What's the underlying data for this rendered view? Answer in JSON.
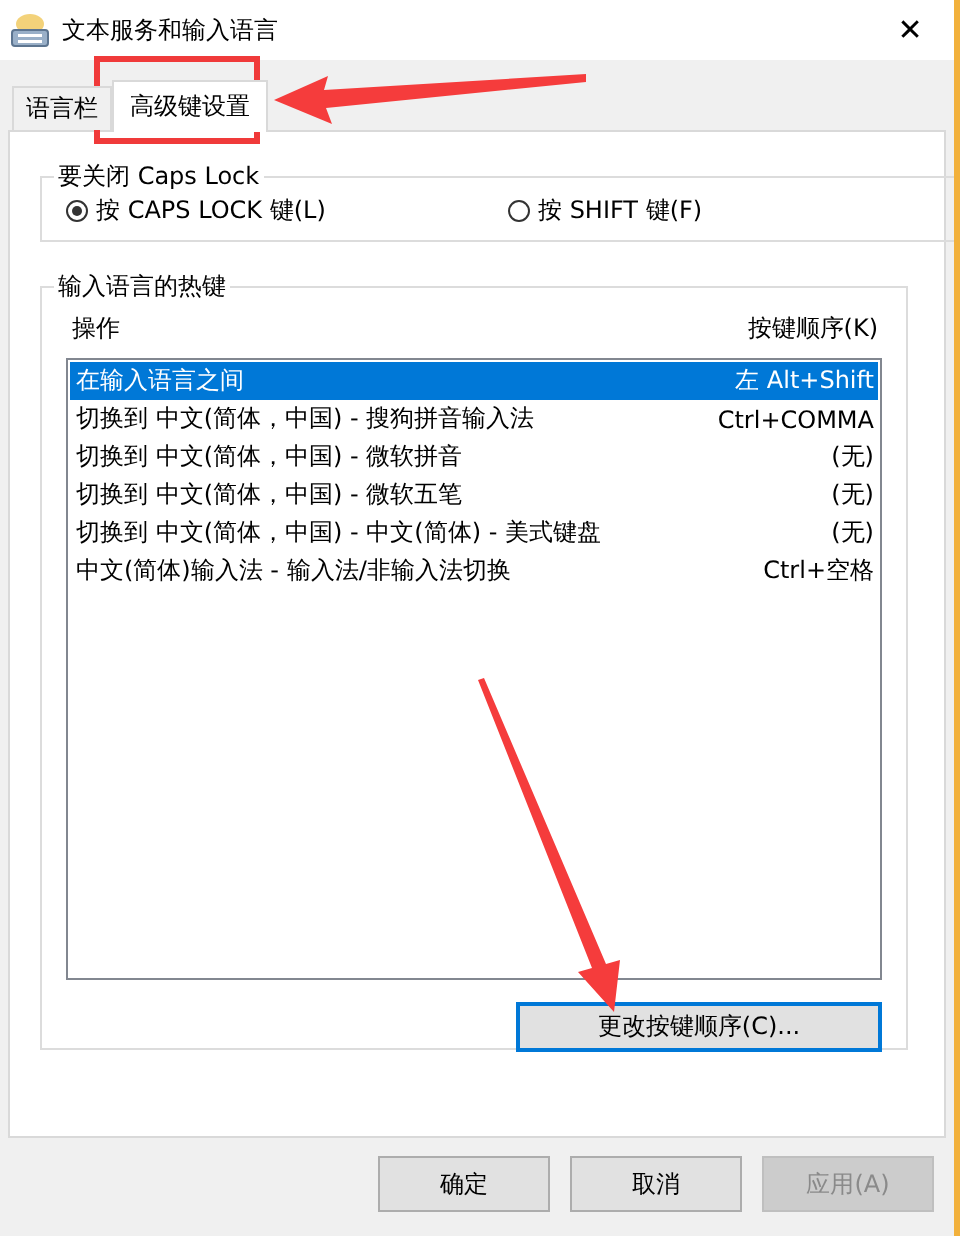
{
  "window": {
    "title": "文本服务和输入语言",
    "close": "✕"
  },
  "tabs": [
    {
      "label": "语言栏",
      "selected": false
    },
    {
      "label": "高级键设置",
      "selected": true
    }
  ],
  "caps_lock_group": {
    "title": "要关闭 Caps Lock",
    "options": [
      {
        "label": "按 CAPS LOCK 键(L)",
        "selected": true
      },
      {
        "label": "按 SHIFT 键(F)",
        "selected": false
      }
    ]
  },
  "hotkey_group": {
    "title": "输入语言的热键",
    "columns": [
      "操作",
      "按键顺序(K)"
    ],
    "rows": [
      {
        "action": "在输入语言之间",
        "keys": "左 Alt+Shift",
        "selected": true
      },
      {
        "action": "切换到 中文(简体，中国) - 搜狗拼音输入法",
        "keys": "Ctrl+COMMA",
        "selected": false
      },
      {
        "action": "切换到 中文(简体，中国) - 微软拼音",
        "keys": "(无)",
        "selected": false
      },
      {
        "action": "切换到 中文(简体，中国) - 微软五笔",
        "keys": "(无)",
        "selected": false
      },
      {
        "action": "切换到 中文(简体，中国) - 中文(简体) - 美式键盘",
        "keys": "(无)",
        "selected": false
      },
      {
        "action": "中文(简体)输入法 - 输入法/非输入法切换",
        "keys": "Ctrl+空格",
        "selected": false
      }
    ],
    "change_button": {
      "label": "更改按键顺序(C)...",
      "focused": true
    }
  },
  "buttons": [
    {
      "label": "确定",
      "disabled": false
    },
    {
      "label": "取消",
      "disabled": false
    },
    {
      "label": "应用(A)",
      "disabled": true
    }
  ]
}
